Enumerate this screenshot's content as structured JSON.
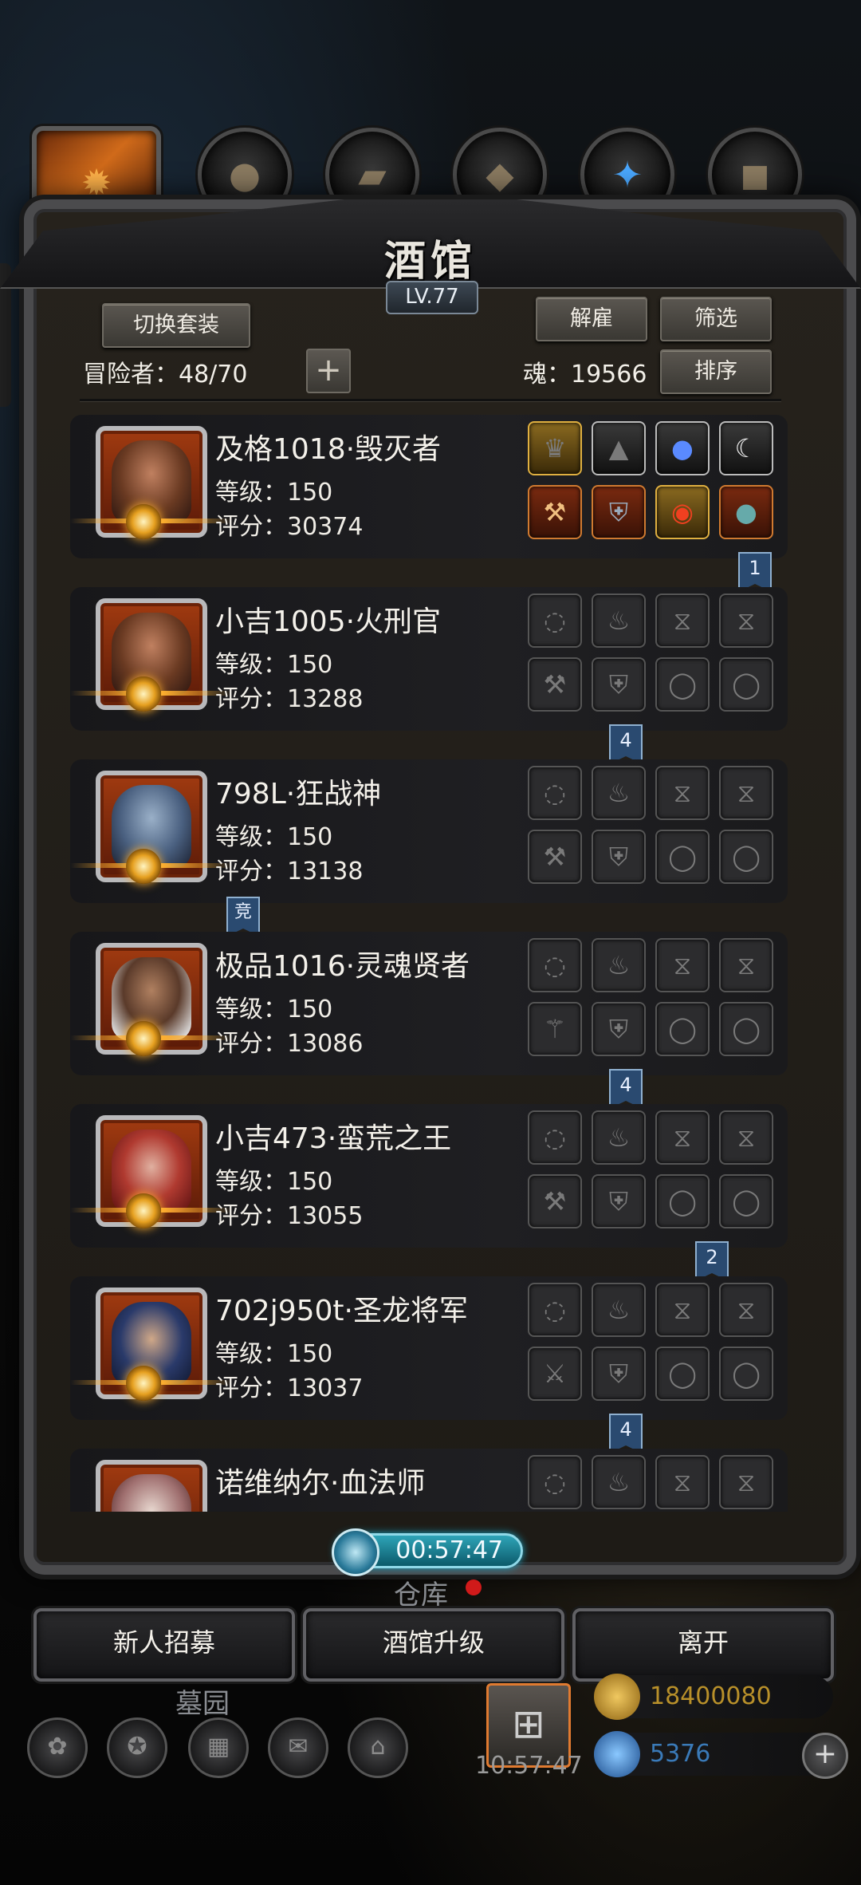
{
  "colors": {
    "frame": "#4b4b4d",
    "panel": "#26221c",
    "card": "#1f1f22",
    "accent_gold": "#ffb030",
    "timer": "#2ea4b8",
    "rank_flag": "#2a4a70"
  },
  "top_tabs": [
    {
      "icon": "tavern-crest-icon",
      "active": true
    },
    {
      "icon": "leather-armor-icon",
      "active": false
    },
    {
      "icon": "wood-planks-icon",
      "active": false
    },
    {
      "icon": "iron-ingots-icon",
      "active": false
    },
    {
      "icon": "blue-crystal-icon",
      "active": false
    },
    {
      "icon": "steel-bars-icon",
      "active": false
    }
  ],
  "header": {
    "title": "酒馆",
    "level": "LV.77",
    "switch_outfit": "切换套装",
    "dismiss": "解雇",
    "filter": "筛选",
    "sort": "排序",
    "adventurers_label": "冒险者：48/70",
    "add": "+",
    "soul_label": "魂：19566"
  },
  "adventurers": [
    {
      "name": "及格1018·毁灭者",
      "level": "等级：150",
      "score": "评分：30374",
      "rank": "1",
      "slots": [
        "flame-crown-icon",
        "boots-icon",
        "potion-icon",
        "claw-icon",
        "axe-icon",
        "armor-icon",
        "ring-icon",
        "orb-icon"
      ],
      "filled": true
    },
    {
      "name": "小吉1005·火刑官",
      "level": "等级：150",
      "score": "评分：13288",
      "rank": "4",
      "slots": [
        "helmet-slot-icon",
        "armor-slot-icon",
        "accessory-slot-icon",
        "accessory-slot-icon",
        "axe-slot-icon",
        "chest-slot-icon",
        "ring-slot-icon",
        "ring-slot-icon"
      ],
      "filled": false
    },
    {
      "name": "798L·狂战神",
      "level": "等级：150",
      "score": "评分：13138",
      "rank": "竞",
      "slots": [
        "helmet-slot-icon",
        "armor-slot-icon",
        "accessory-slot-icon",
        "accessory-slot-icon",
        "axe-slot-icon",
        "chest-slot-icon",
        "ring-slot-icon",
        "ring-slot-icon"
      ],
      "filled": false
    },
    {
      "name": "极品1016·灵魂贤者",
      "level": "等级：150",
      "score": "评分：13086",
      "rank": "4",
      "slots": [
        "helmet-slot-icon",
        "armor-slot-icon",
        "accessory-slot-icon",
        "accessory-slot-icon",
        "staff-slot-icon",
        "chest-slot-icon",
        "ring-slot-icon",
        "ring-slot-icon"
      ],
      "filled": false
    },
    {
      "name": "小吉473·蛮荒之王",
      "level": "等级：150",
      "score": "评分：13055",
      "rank": "2",
      "slots": [
        "helmet-slot-icon",
        "armor-slot-icon",
        "accessory-slot-icon",
        "accessory-slot-icon",
        "axe-slot-icon",
        "chest-slot-icon",
        "ring-slot-icon",
        "ring-slot-icon"
      ],
      "filled": false
    },
    {
      "name": "702j950t·圣龙将军",
      "level": "等级：150",
      "score": "评分：13037",
      "rank": "4",
      "slots": [
        "helmet-slot-icon",
        "armor-slot-icon",
        "accessory-slot-icon",
        "accessory-slot-icon",
        "sword-slot-icon",
        "chest-slot-icon",
        "ring-slot-icon",
        "ring-slot-icon"
      ],
      "filled": false
    },
    {
      "name": "诺维纳尔·血法师",
      "level": "",
      "score": "",
      "rank": "",
      "slots": [
        "helmet-slot-icon",
        "armor-slot-icon",
        "accessory-slot-icon",
        "accessory-slot-icon"
      ],
      "filled": false
    }
  ],
  "footer": {
    "timer": "00:57:47",
    "warehouse": "仓库",
    "recruit": "新人招募",
    "upgrade": "酒馆升级",
    "leave": "离开",
    "graveyard": "墓园",
    "gold": "18400080",
    "gems": "5376",
    "clock": "10:57:47"
  }
}
